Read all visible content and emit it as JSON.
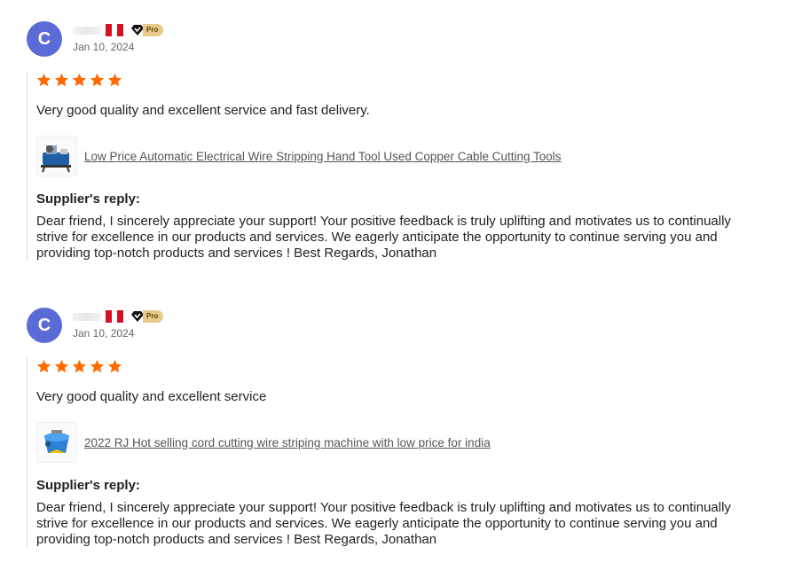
{
  "reviews": [
    {
      "avatar_letter": "C",
      "date": "Jan 10, 2024",
      "badge": "Pro",
      "rating": 5,
      "text": "Very good quality and excellent service and fast delivery.",
      "product_icon": "wire-stripping-machine-icon",
      "product_title": "Low Price Automatic Electrical Wire Stripping Hand Tool Used Copper Cable Cutting Tools",
      "reply_title": "Supplier's reply:",
      "reply_text": "Dear friend, I sincerely appreciate your support! Your positive feedback is truly uplifting and motivates us to continually strive for excellence in our products and services. We eagerly anticipate the opportunity to continue serving you and providing top-notch products and services ! Best Regards, Jonathan"
    },
    {
      "avatar_letter": "C",
      "date": "Jan 10, 2024",
      "badge": "Pro",
      "rating": 5,
      "text": "Very good quality and excellent service",
      "product_icon": "cord-cutting-machine-icon",
      "product_title": "2022 RJ Hot selling cord cutting wire striping machine with low price for india",
      "reply_title": "Supplier's reply:",
      "reply_text": "Dear friend, I sincerely appreciate your support! Your positive feedback is truly uplifting and motivates us to continually strive for excellence in our products and services. We eagerly anticipate the opportunity to continue serving you and providing top-notch products and services ! Best Regards, Jonathan"
    }
  ],
  "colors": {
    "star": "#ff6a00",
    "avatar": "#5b6bd6",
    "flag_red": "#d91023",
    "pro_badge": "#e8c98c"
  }
}
